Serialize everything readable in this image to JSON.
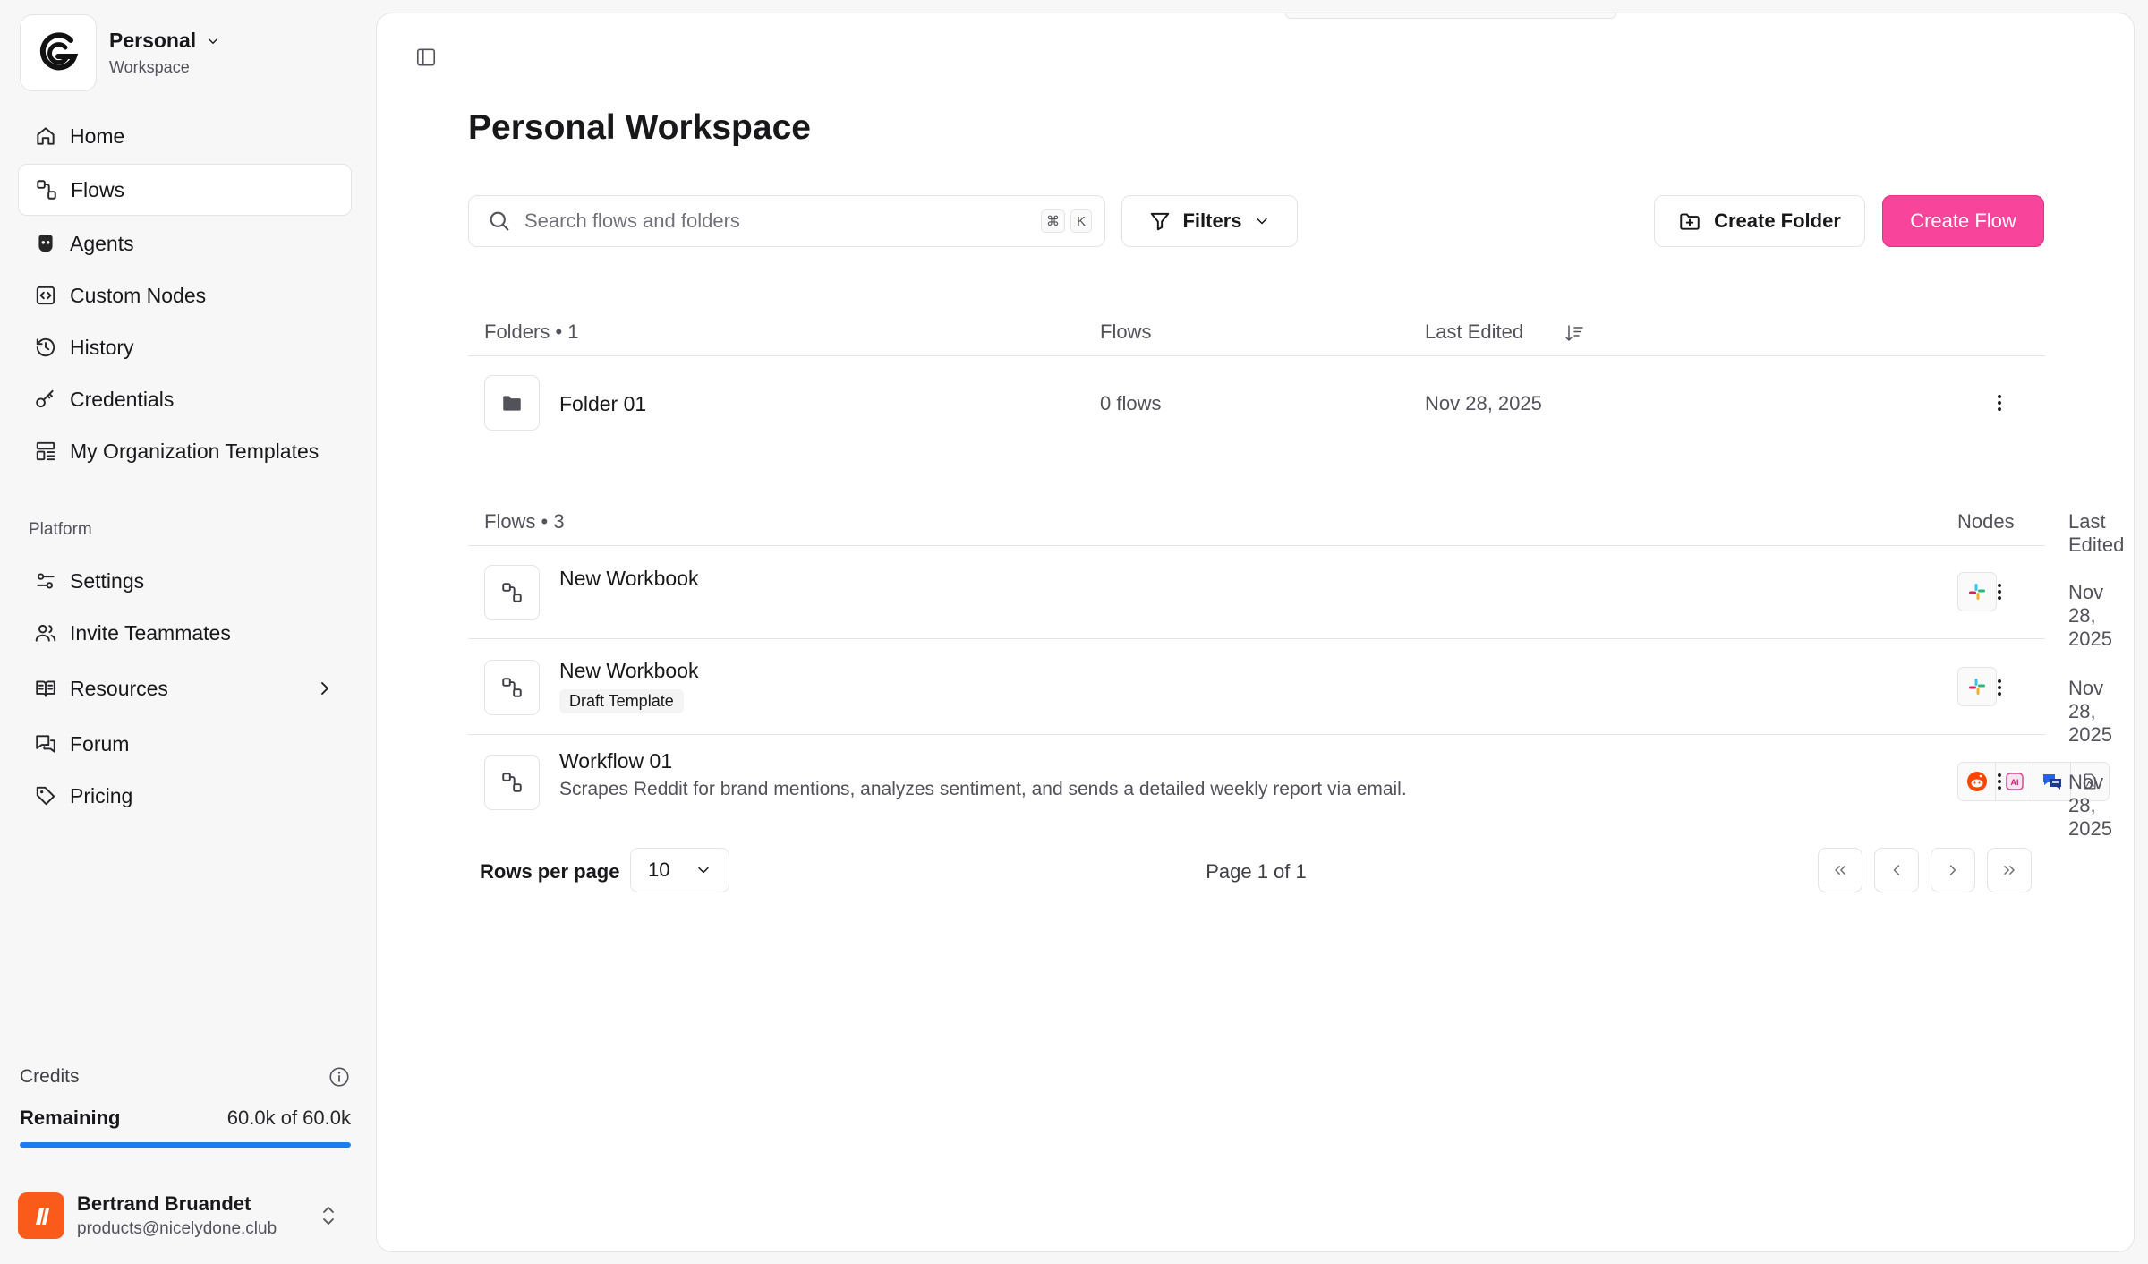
{
  "workspace": {
    "name": "Personal",
    "subtitle": "Workspace"
  },
  "nav": {
    "home": "Home",
    "flows": "Flows",
    "agents": "Agents",
    "custom_nodes": "Custom Nodes",
    "history": "History",
    "credentials": "Credentials",
    "org_templates": "My Organization Templates"
  },
  "platform": {
    "label": "Platform",
    "settings": "Settings",
    "invite": "Invite Teammates",
    "resources": "Resources",
    "forum": "Forum",
    "pricing": "Pricing"
  },
  "credits": {
    "label": "Credits",
    "remaining_label": "Remaining",
    "remaining_value": "60.0k of 60.0k",
    "fraction_remaining": 1.0
  },
  "user": {
    "name": "Bertrand Bruandet",
    "email": "products@nicelydone.club"
  },
  "page": {
    "title": "Personal Workspace"
  },
  "search": {
    "placeholder": "Search flows and folders",
    "value": "",
    "shortcut_mod": "⌘",
    "shortcut_key": "K"
  },
  "toolbar": {
    "filters": "Filters",
    "create_folder": "Create Folder",
    "create_flow": "Create Flow"
  },
  "folders_table": {
    "header": "Folders • 1",
    "col_flows": "Flows",
    "col_last_edited": "Last Edited",
    "rows": [
      {
        "name": "Folder 01",
        "flows": "0 flows",
        "last_edited": "Nov 28, 2025"
      }
    ]
  },
  "flows_table": {
    "header": "Flows • 3",
    "col_nodes": "Nodes",
    "col_last_edited": "Last Edited",
    "rows": [
      {
        "name": "New Workbook",
        "badge": "",
        "description": "",
        "nodes": [
          "slack-icon"
        ],
        "last_edited": "Nov 28, 2025"
      },
      {
        "name": "New Workbook",
        "badge": "Draft Template",
        "description": "",
        "nodes": [
          "slack-icon"
        ],
        "last_edited": "Nov 28, 2025"
      },
      {
        "name": "Workflow 01",
        "badge": "",
        "description": "Scrapes Reddit for brand mentions, analyzes sentiment, and sends a detailed weekly report via email.",
        "nodes": [
          "reddit-icon",
          "ai-icon",
          "chat-icon",
          "document-icon"
        ],
        "last_edited": "Nov 28, 2025"
      }
    ]
  },
  "pagination": {
    "rows_per_page_label": "Rows per page",
    "rows_per_page_value": "10",
    "page_info": "Page 1 of 1"
  },
  "colors": {
    "accent": "#f8449a",
    "progress": "#1d7bf0",
    "avatar": "#fb5b1a",
    "reddit": "#ff4500"
  }
}
